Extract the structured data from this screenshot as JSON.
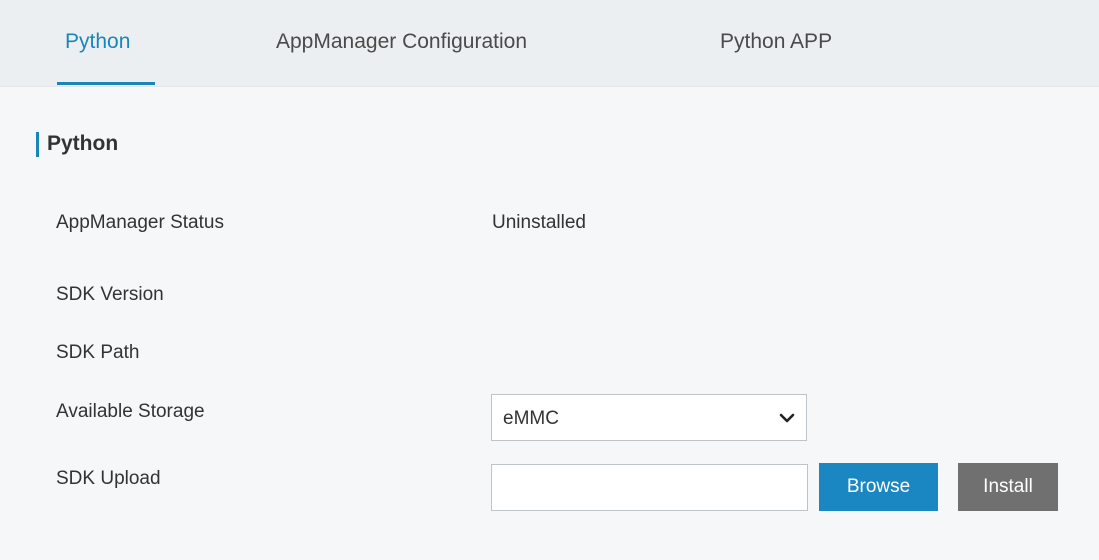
{
  "tabs": {
    "python": "Python",
    "appmanager_configuration": "AppManager Configuration",
    "python_app": "Python APP"
  },
  "section": {
    "title": "Python"
  },
  "fields": {
    "appmanager_status_label": "AppManager Status",
    "appmanager_status_value": "Uninstalled",
    "sdk_version_label": "SDK Version",
    "sdk_path_label": "SDK Path",
    "available_storage_label": "Available Storage",
    "available_storage_value": "eMMC",
    "sdk_upload_label": "SDK Upload"
  },
  "buttons": {
    "browse": "Browse",
    "install": "Install"
  },
  "colors": {
    "accent": "#1a86b8",
    "browse_button": "#1a86c2",
    "install_button": "#707070"
  }
}
